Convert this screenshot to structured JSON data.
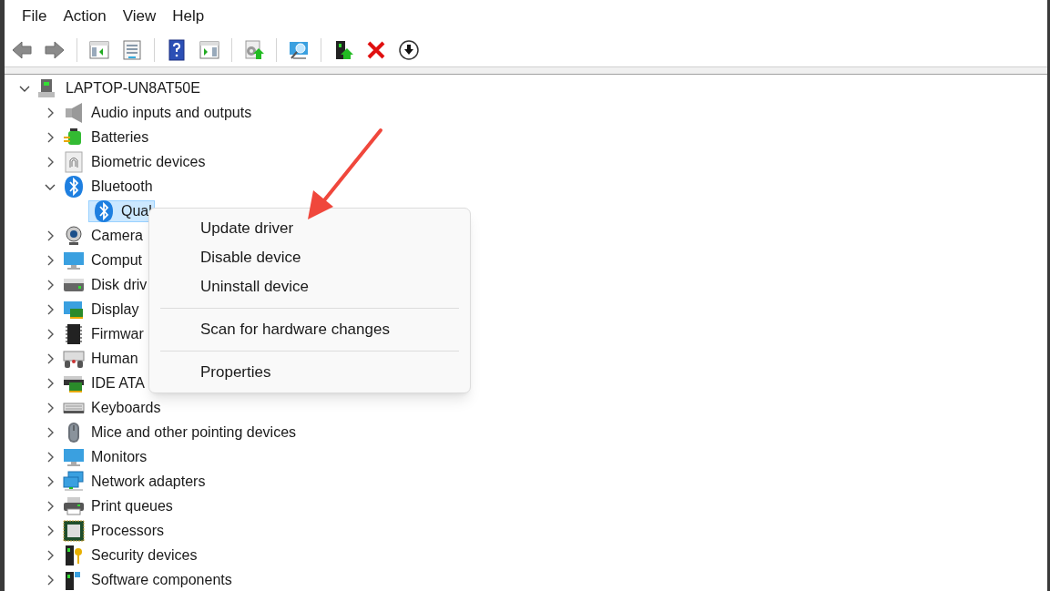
{
  "menu_bar": [
    "File",
    "Action",
    "View",
    "Help"
  ],
  "tree": {
    "label": "LAPTOP-UN8AT50E",
    "expanded": true,
    "children": [
      {
        "label": "Audio inputs and outputs",
        "expanded": false
      },
      {
        "label": "Batteries",
        "expanded": false
      },
      {
        "label": "Biometric devices",
        "expanded": false
      },
      {
        "label": "Bluetooth",
        "expanded": true,
        "children": [
          {
            "label": "Qual",
            "selected": true
          }
        ]
      },
      {
        "label": "Camera",
        "expanded": false
      },
      {
        "label": "Comput",
        "expanded": false
      },
      {
        "label": "Disk driv",
        "expanded": false
      },
      {
        "label": "Display",
        "expanded": false
      },
      {
        "label": "Firmwar",
        "expanded": false
      },
      {
        "label": "Human",
        "expanded": false
      },
      {
        "label": "IDE ATA",
        "expanded": false
      },
      {
        "label": "Keyboards",
        "expanded": false
      },
      {
        "label": "Mice and other pointing devices",
        "expanded": false
      },
      {
        "label": "Monitors",
        "expanded": false
      },
      {
        "label": "Network adapters",
        "expanded": false
      },
      {
        "label": "Print queues",
        "expanded": false
      },
      {
        "label": "Processors",
        "expanded": false
      },
      {
        "label": "Security devices",
        "expanded": false
      },
      {
        "label": "Software components",
        "expanded": false
      }
    ]
  },
  "context_menu": {
    "items": [
      {
        "kind": "item",
        "label": "Update driver"
      },
      {
        "kind": "item",
        "label": "Disable device"
      },
      {
        "kind": "item",
        "label": "Uninstall device"
      },
      {
        "kind": "separator"
      },
      {
        "kind": "item",
        "label": "Scan for hardware changes"
      },
      {
        "kind": "separator"
      },
      {
        "kind": "item",
        "label": "Properties"
      }
    ]
  }
}
